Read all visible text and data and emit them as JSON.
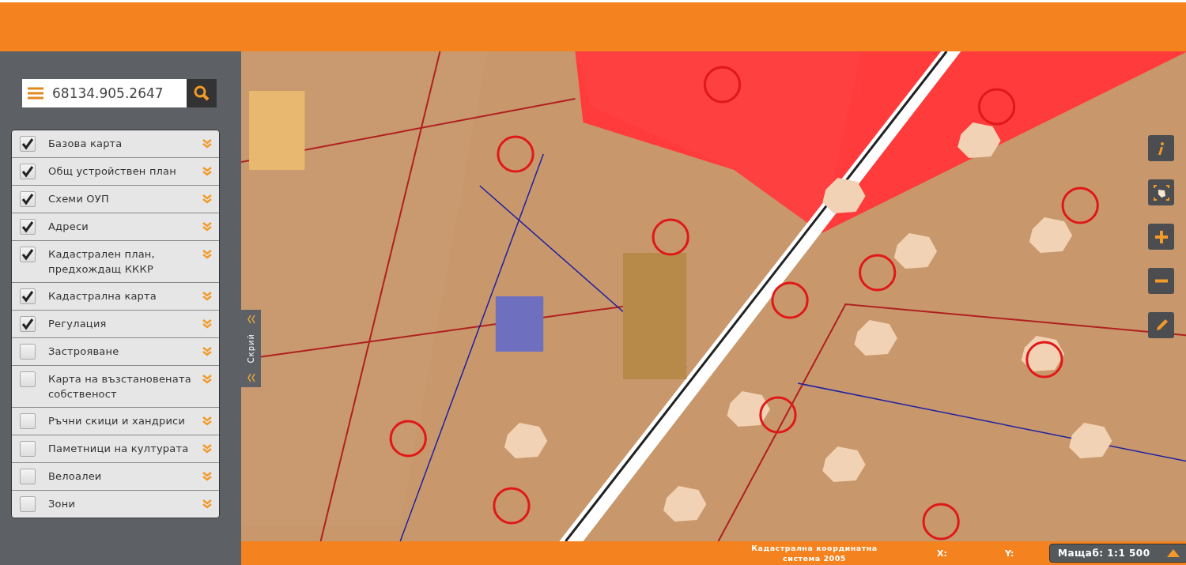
{
  "search": {
    "value": "68134.905.2647"
  },
  "layers": [
    {
      "label": "Базова карта",
      "checked": true
    },
    {
      "label": "Общ устройствен план",
      "checked": true
    },
    {
      "label": "Схеми ОУП",
      "checked": true
    },
    {
      "label": "Адреси",
      "checked": true
    },
    {
      "label": "Кадастрален план, предхождащ КККР",
      "checked": true
    },
    {
      "label": "Кадастрална карта",
      "checked": true
    },
    {
      "label": "Регулация",
      "checked": true
    },
    {
      "label": "Застрояване",
      "checked": false
    },
    {
      "label": "Карта на възстановената собственост",
      "checked": false
    },
    {
      "label": "Ръчни скици и хандриси",
      "checked": false
    },
    {
      "label": "Паметници на културата",
      "checked": false
    },
    {
      "label": "Велоалеи",
      "checked": false
    },
    {
      "label": "Зони",
      "checked": false
    }
  ],
  "collapse_tab": {
    "label": "Скрий"
  },
  "map_tools": [
    {
      "kind": "info"
    },
    {
      "kind": "extent"
    },
    {
      "kind": "zoom-in"
    },
    {
      "kind": "zoom-out"
    },
    {
      "kind": "draw"
    }
  ],
  "status_bar": {
    "coordinate_system": "Кадастрална координатна система 2005",
    "x_label": "X:",
    "y_label": "Y:",
    "scale": "Мащаб: 1:1 500"
  }
}
